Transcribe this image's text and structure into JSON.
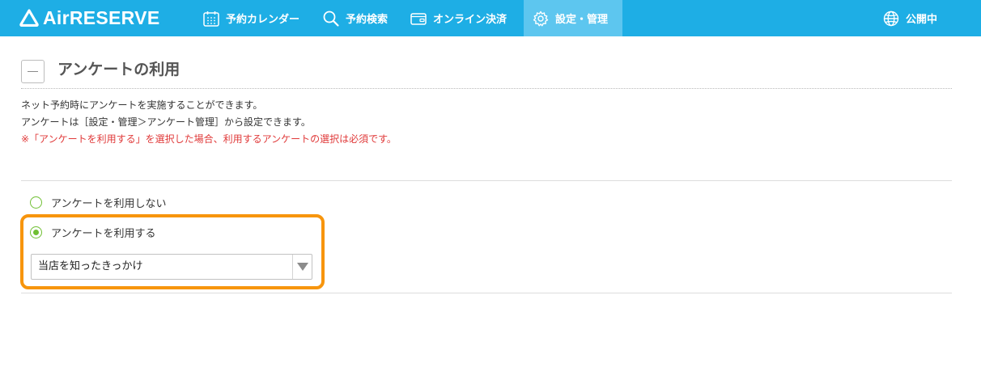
{
  "app": {
    "logo_text": "AirRESERVE"
  },
  "nav": {
    "items": [
      {
        "label": "予約カレンダー",
        "icon": "calendar-icon"
      },
      {
        "label": "予約検索",
        "icon": "search-icon"
      },
      {
        "label": "オンライン決済",
        "icon": "wallet-icon"
      },
      {
        "label": "設定・管理",
        "icon": "gear-icon",
        "active": true
      }
    ],
    "public_status": {
      "label": "公開中",
      "icon": "globe-icon"
    }
  },
  "section": {
    "title": "アンケートの利用",
    "description_lines": [
      "ネット予約時にアンケートを実施することができます。",
      "アンケートは［設定・管理＞アンケート管理］から設定できます。"
    ],
    "note": "※「アンケートを利用する」を選択した場合、利用するアンケートの選択は必須です。"
  },
  "options": {
    "no_use": {
      "label": "アンケートを利用しない",
      "checked": false
    },
    "use": {
      "label": "アンケートを利用する",
      "checked": true
    }
  },
  "survey_select": {
    "value": "当店を知ったきっかけ"
  },
  "colors": {
    "header": "#1eaee5",
    "active_tab": "#5dc6ef",
    "note": "#e03a3a",
    "radio": "#6fbf32",
    "highlight": "#f7950d"
  }
}
